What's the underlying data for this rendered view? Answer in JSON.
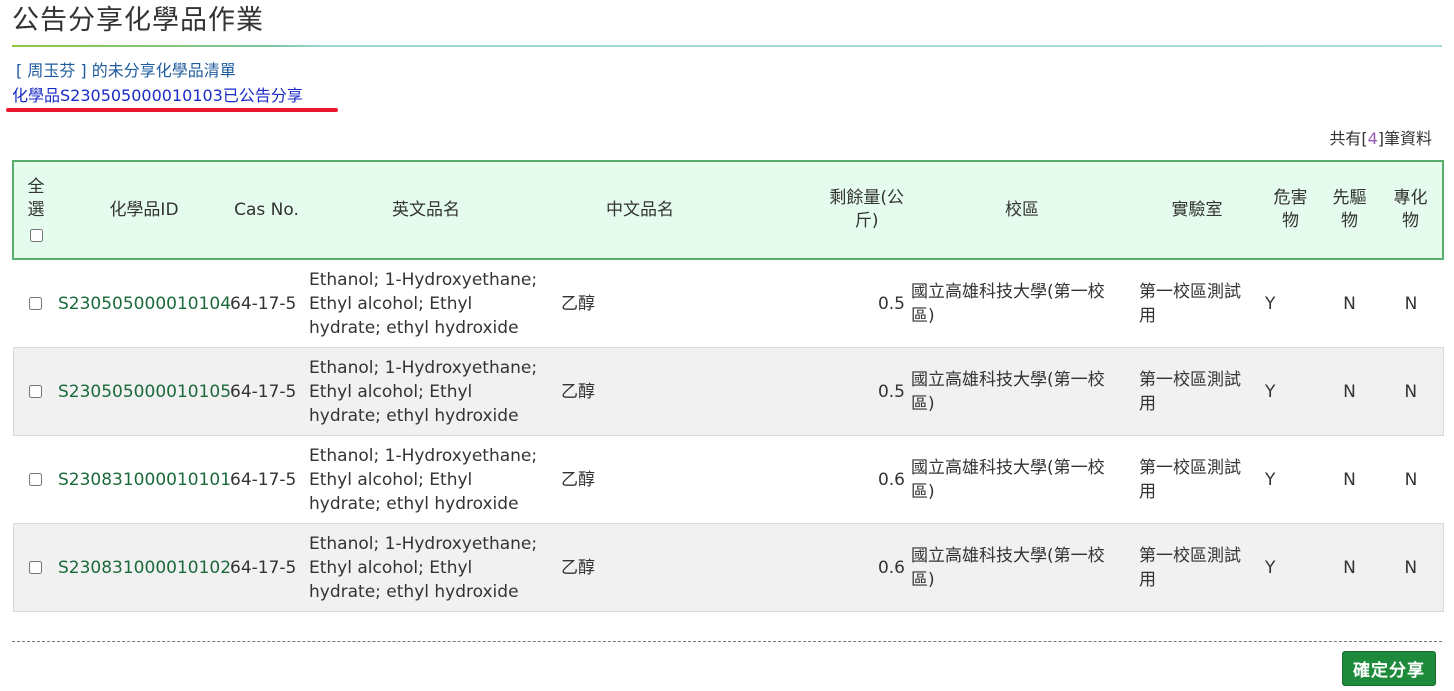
{
  "page": {
    "title": "公告分享化學品作業",
    "owner_list_text": "[ 周玉芬 ] 的未分享化學品清單",
    "announce_text": "化學品S230505000010103已公告分享",
    "total_prefix": "共有[",
    "total_count": "4",
    "total_suffix": "]筆資料"
  },
  "table": {
    "headers": {
      "select_all": "全選",
      "id": "化學品ID",
      "cas": "Cas No.",
      "en_name": "英文品名",
      "zh_name": "中文品名",
      "remaining": "剩餘量(公斤)",
      "campus": "校區",
      "lab": "實驗室",
      "hazard": "危害物",
      "precursor": "先驅物",
      "toxic": "專化物"
    },
    "rows": [
      {
        "id": "S230505000010104",
        "cas": "64-17-5",
        "en_name": "Ethanol; 1-Hydroxyethane; Ethyl alcohol; Ethyl hydrate; ethyl hydroxide",
        "zh_name": "乙醇",
        "remaining": "0.5",
        "campus": "國立高雄科技大學(第一校區)",
        "lab": "第一校區測試用",
        "hazard": "Y",
        "precursor": "N",
        "toxic": "N"
      },
      {
        "id": "S230505000010105",
        "cas": "64-17-5",
        "en_name": "Ethanol; 1-Hydroxyethane; Ethyl alcohol; Ethyl hydrate; ethyl hydroxide",
        "zh_name": "乙醇",
        "remaining": "0.5",
        "campus": "國立高雄科技大學(第一校區)",
        "lab": "第一校區測試用",
        "hazard": "Y",
        "precursor": "N",
        "toxic": "N"
      },
      {
        "id": "S230831000010101",
        "cas": "64-17-5",
        "en_name": "Ethanol; 1-Hydroxyethane; Ethyl alcohol; Ethyl hydrate; ethyl hydroxide",
        "zh_name": "乙醇",
        "remaining": "0.6",
        "campus": "國立高雄科技大學(第一校區)",
        "lab": "第一校區測試用",
        "hazard": "Y",
        "precursor": "N",
        "toxic": "N"
      },
      {
        "id": "S230831000010102",
        "cas": "64-17-5",
        "en_name": "Ethanol; 1-Hydroxyethane; Ethyl alcohol; Ethyl hydrate; ethyl hydroxide",
        "zh_name": "乙醇",
        "remaining": "0.6",
        "campus": "國立高雄科技大學(第一校區)",
        "lab": "第一校區測試用",
        "hazard": "Y",
        "precursor": "N",
        "toxic": "N"
      }
    ]
  },
  "actions": {
    "confirm_label": "確定分享"
  },
  "colors": {
    "header_bg": "#e5fbee",
    "header_border": "#5aad6a",
    "button_bg": "#1e8a3c",
    "announce_underline": "#e8192c"
  }
}
